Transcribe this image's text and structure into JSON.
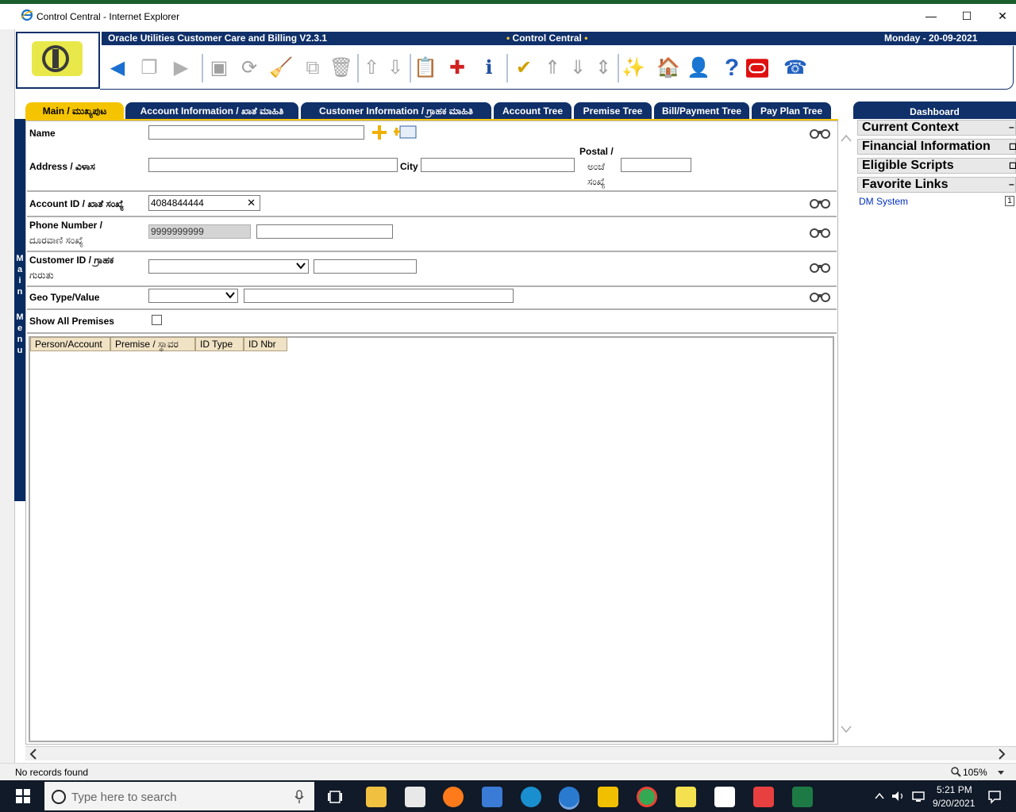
{
  "window": {
    "title": "Control Central - Internet Explorer",
    "minimize": "—",
    "maximize": "☐",
    "close": "✕"
  },
  "header": {
    "app_name": "Oracle Utilities Customer Care and Billing V2.3.1",
    "page_name": "Control Central",
    "date": "Monday - 20-09-2021"
  },
  "side_menu_label": [
    "M",
    "a",
    "i",
    "n",
    "",
    "M",
    "e",
    "n",
    "u"
  ],
  "tabs": [
    {
      "label": "Main / ಮುಖ್ಯಪುಟ"
    },
    {
      "label": "Account Information / ಖಾತೆ ಮಾಹಿತಿ"
    },
    {
      "label": "Customer Information / ಗ್ರಾಹಕ ಮಾಹಿತಿ"
    },
    {
      "label": "Account Tree"
    },
    {
      "label": "Premise Tree"
    },
    {
      "label": "Bill/Payment Tree"
    },
    {
      "label": "Pay Plan Tree"
    }
  ],
  "form": {
    "name_label": "Name",
    "address_label": "Address / ವಿಳಾಸ",
    "city_label": "City",
    "postal_label_1": "Postal /",
    "postal_label_2": "ಅಂಚೆ",
    "postal_label_3": "ಸಂಖ್ಯೆ",
    "account_label": "Account ID / ಖಾತೆ ಸಂಖ್ಯೆ",
    "account_value": "4084844444",
    "clear_symbol": "✕",
    "phone_label_1": "Phone Number /",
    "phone_label_2": "ದೂರವಾಣಿ ಸಂಖ್ಯೆ",
    "phone_type_value": "9999999999",
    "customer_label_1": "Customer ID / ಗ್ರಾಹಕ",
    "customer_label_2": "ಗುರುತು",
    "geo_label": "Geo Type/Value",
    "show_all_label": "Show All Premises"
  },
  "grid": {
    "columns": [
      "Person/Account",
      "Premise / ಸ್ಥಾವರ",
      "ID Type",
      "ID Nbr"
    ]
  },
  "status": {
    "message": "No records found",
    "zoom": "105%"
  },
  "dashboard": {
    "title": "Dashboard",
    "sections": [
      {
        "label": "Current Context",
        "btn": "–"
      },
      {
        "label": "Financial Information",
        "btn": "◻"
      },
      {
        "label": "Eligible Scripts",
        "btn": "◻"
      },
      {
        "label": "Favorite Links",
        "btn": "–"
      }
    ],
    "link": "DM System",
    "link_btn": "1"
  },
  "taskbar": {
    "search_placeholder": "Type here to search",
    "time": "5:21 PM",
    "date": "9/20/2021"
  },
  "colors": {
    "navy": "#10306a",
    "tab_active": "#f5c400",
    "header_accent": "#ffcc33"
  }
}
